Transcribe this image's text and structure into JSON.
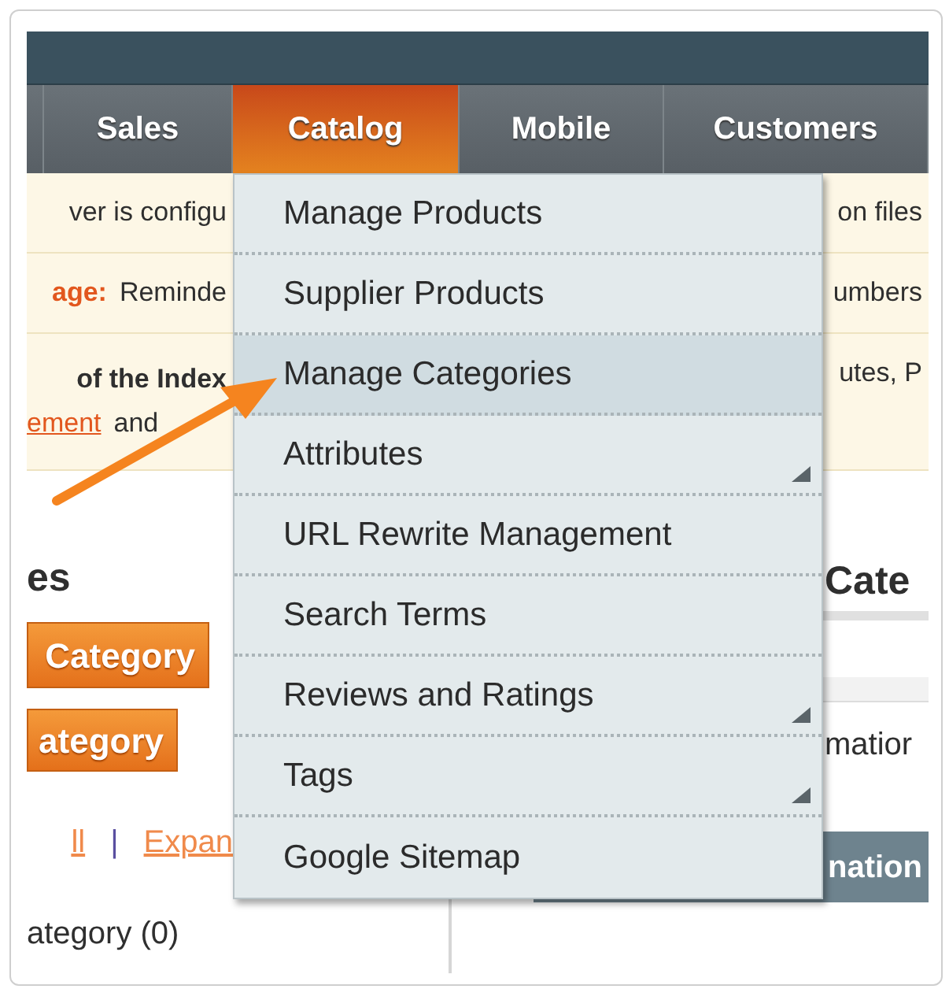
{
  "nav": {
    "tabs": [
      {
        "label": "Sales",
        "selected": false
      },
      {
        "label": "Catalog",
        "selected": true
      },
      {
        "label": "Mobile",
        "selected": false
      },
      {
        "label": "Customers",
        "selected": false
      }
    ]
  },
  "notices": [
    {
      "lines": [
        [
          {
            "kind": "plain",
            "text": "ver is configu"
          }
        ]
      ],
      "right": "on files"
    },
    {
      "lines": [
        [
          {
            "kind": "warning",
            "text": "age:"
          },
          {
            "kind": "plain",
            "text": "Reminde"
          }
        ]
      ],
      "right": "umbers"
    },
    {
      "lines": [
        [
          {
            "kind": "bold",
            "text": "of the Index"
          }
        ],
        [
          {
            "kind": "link",
            "text": "ement"
          },
          {
            "kind": "plain",
            "text": "and"
          }
        ]
      ],
      "right": "utes, P"
    }
  ],
  "categories_panel": {
    "heading": "es",
    "buttons": [
      "Category",
      "ategory"
    ],
    "links": [
      "ll",
      "Expan"
    ],
    "separator": "|",
    "tree_item": "ategory (0)"
  },
  "edit_panel": {
    "heading": "Cate",
    "field_label": "matior",
    "section_header": "nation"
  },
  "menu": {
    "items": [
      {
        "label": "Manage Products",
        "selected": false,
        "has_submenu": false
      },
      {
        "label": "Supplier Products",
        "selected": false,
        "has_submenu": false
      },
      {
        "label": "Manage Categories",
        "selected": true,
        "has_submenu": false
      },
      {
        "label": "Attributes",
        "selected": false,
        "has_submenu": true
      },
      {
        "label": "URL Rewrite Management",
        "selected": false,
        "has_submenu": false
      },
      {
        "label": "Search Terms",
        "selected": false,
        "has_submenu": false
      },
      {
        "label": "Reviews and Ratings",
        "selected": false,
        "has_submenu": true
      },
      {
        "label": "Tags",
        "selected": false,
        "has_submenu": true
      },
      {
        "label": "Google Sitemap",
        "selected": false,
        "has_submenu": false
      }
    ]
  }
}
